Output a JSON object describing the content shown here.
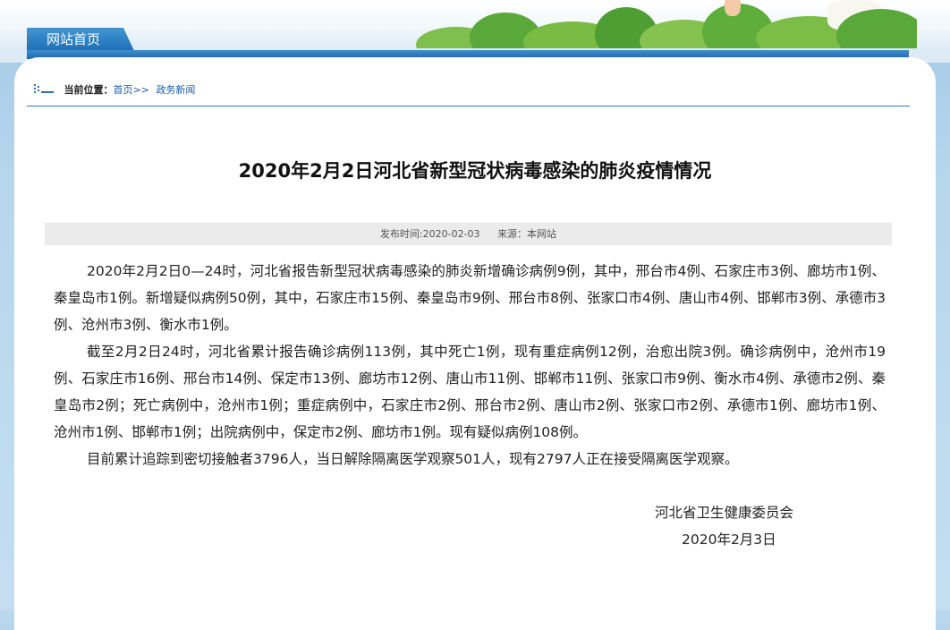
{
  "header": {
    "home_tab_label": "网站首页",
    "accent_color": "#1f6fb4"
  },
  "breadcrumb": {
    "label": "当前位置：",
    "home_link": "首页",
    "separator": ">>",
    "section_link": "政务新闻"
  },
  "article": {
    "title": "2020年2月2日河北省新型冠状病毒感染的肺炎疫情情况",
    "publish_label": "发布时间:2020-02-03",
    "source_label": "来源：本网站",
    "paragraphs": [
      "2020年2月2日0—24时，河北省报告新型冠状病毒感染的肺炎新增确诊病例9例，其中，邢台市4例、石家庄市3例、廊坊市1例、秦皇岛市1例。新增疑似病例50例，其中，石家庄市15例、秦皇岛市9例、邢台市8例、张家口市4例、唐山市4例、邯郸市3例、承德市3例、沧州市3例、衡水市1例。",
      "截至2月2日24时，河北省累计报告确诊病例113例，其中死亡1例，现有重症病例12例，治愈出院3例。确诊病例中，沧州市19例、石家庄市16例、邢台市14例、保定市13例、廊坊市12例、唐山市11例、邯郸市11例、张家口市9例、衡水市4例、承德市2例、秦皇岛市2例；死亡病例中，沧州市1例；重症病例中，石家庄市2例、邢台市2例、唐山市2例、张家口市2例、承德市1例、廊坊市1例、沧州市1例、邯郸市1例；出院病例中，保定市2例、廊坊市1例。现有疑似病例108例。",
      "目前累计追踪到密切接触者3796人，当日解除隔离医学观察501人，现有2797人正在接受隔离医学观察。"
    ],
    "signature_org": "河北省卫生健康委员会",
    "signature_date": "2020年2月3日"
  }
}
